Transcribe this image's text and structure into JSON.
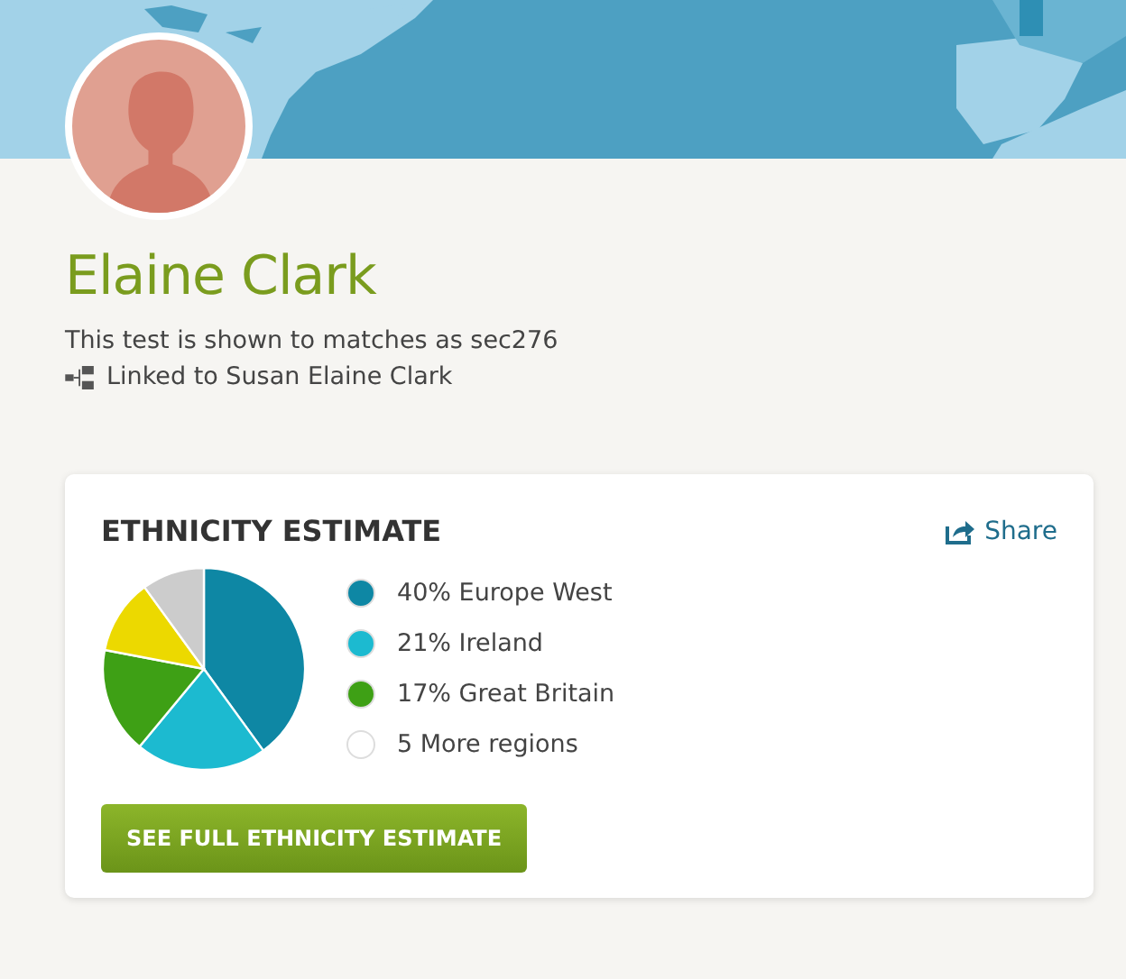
{
  "profile": {
    "name": "Elaine Clark",
    "subtitle": "This test is shown to matches as sec276",
    "linked": "Linked to Susan Elaine Clark"
  },
  "card": {
    "title": "ETHNICITY ESTIMATE",
    "share": "Share",
    "chart_data": {
      "type": "pie",
      "values": [
        40,
        21,
        17,
        12,
        10
      ],
      "colors": [
        "#0e87a4",
        "#1cbad0",
        "#3ea015",
        "#ecd900",
        "#cccccc"
      ]
    },
    "legend": [
      {
        "label": "40% Europe West",
        "color": "#0e87a4"
      },
      {
        "label": "21% Ireland",
        "color": "#1cbad0"
      },
      {
        "label": "17% Great Britain",
        "color": "#3ea015"
      },
      {
        "label": "5 More regions",
        "color": "#ffffff"
      }
    ],
    "button": "SEE FULL ETHNICITY ESTIMATE"
  }
}
